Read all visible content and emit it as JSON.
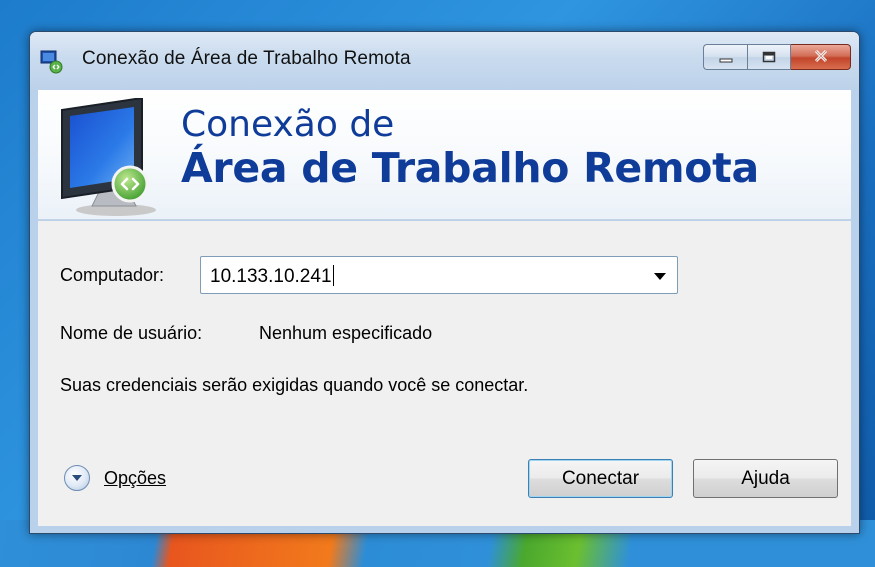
{
  "window": {
    "title": "Conexão de Área de Trabalho Remota",
    "controls": {
      "minimize": "minimize",
      "maximize": "maximize",
      "close": "close"
    }
  },
  "banner": {
    "line1": "Conexão de",
    "line2": "Área de Trabalho Remota"
  },
  "form": {
    "computer_label": "Computador:",
    "computer_value": "10.133.10.241",
    "username_label": "Nome de usuário:",
    "username_value": "Nenhum especificado",
    "credentials_note": "Suas credenciais serão exigidas quando você se conectar."
  },
  "footer": {
    "options_label": "Opções",
    "connect_button": "Conectar",
    "help_button": "Ajuda"
  },
  "colors": {
    "banner_text": "#0f3b99",
    "close_button": "#c2452b",
    "titlebar": "#c9dbee"
  },
  "icons": [
    "remote-desktop-app-icon",
    "minimize-icon",
    "maximize-icon",
    "close-icon",
    "remote-monitor-icon",
    "chevron-down-icon",
    "expand-circle-icon"
  ]
}
